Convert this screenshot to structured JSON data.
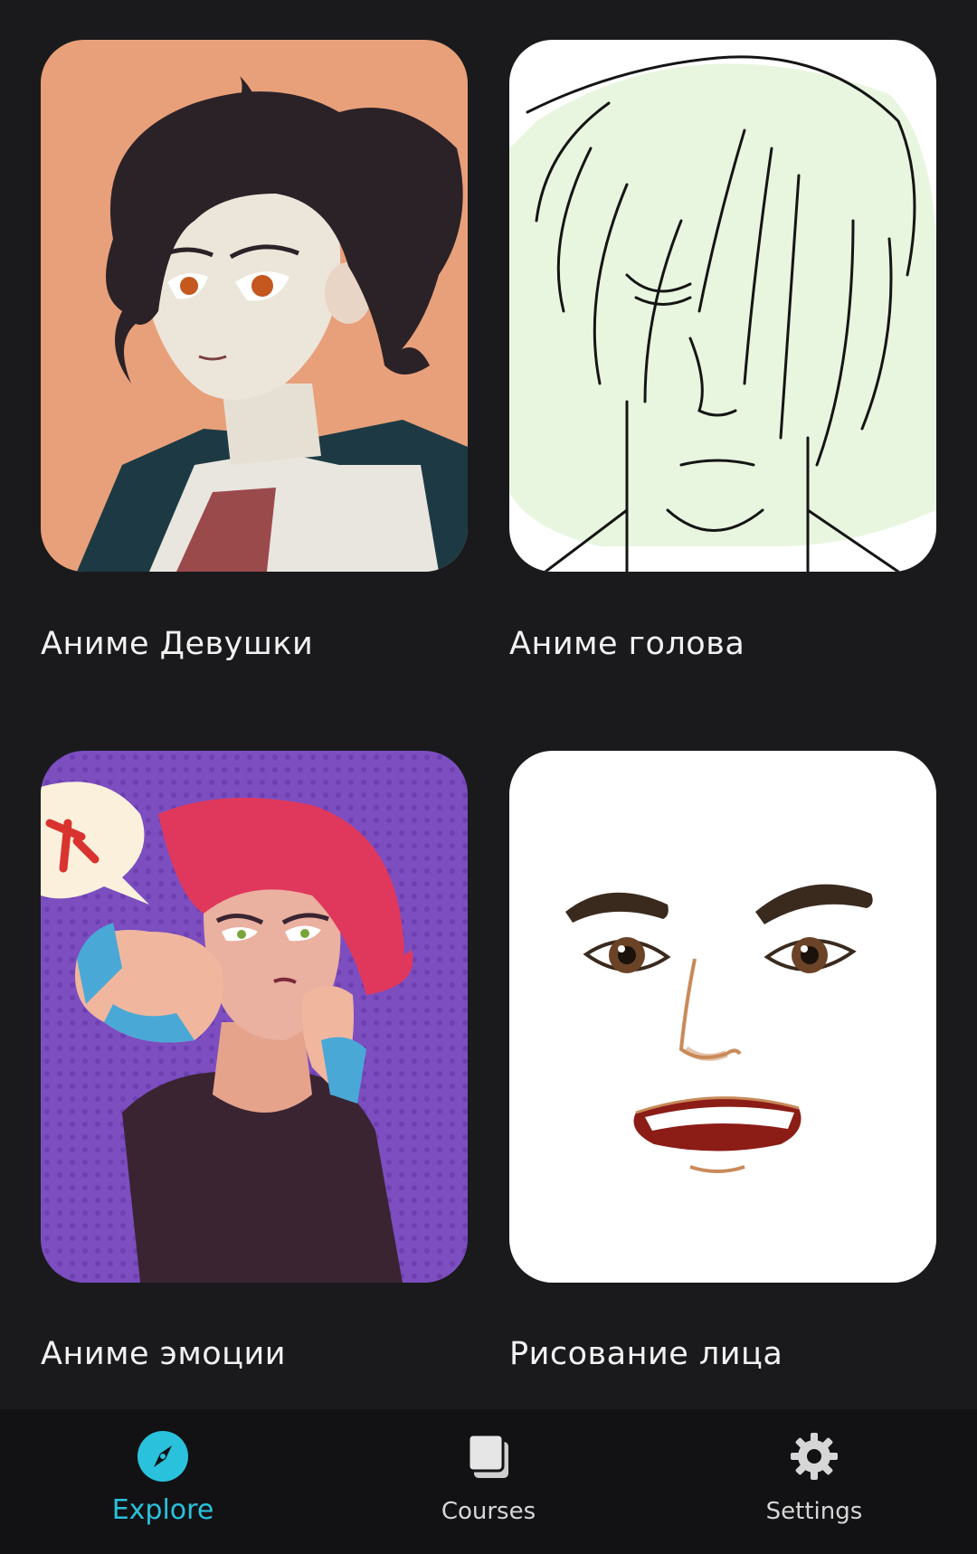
{
  "courses": [
    {
      "title": "Аниме Девушки",
      "icon": "anime-girl-illustration"
    },
    {
      "title": "Аниме голова",
      "icon": "anime-head-sketch"
    },
    {
      "title": "Аниме эмоции",
      "icon": "anime-emotions-illustration"
    },
    {
      "title": "Рисование лица",
      "icon": "angry-face-illustration"
    }
  ],
  "nav": {
    "items": [
      {
        "label": "Explore",
        "icon": "compass-icon",
        "active": true
      },
      {
        "label": "Courses",
        "icon": "stack-icon",
        "active": false
      },
      {
        "label": "Settings",
        "icon": "gear-icon",
        "active": false
      }
    ]
  },
  "colors": {
    "background": "#1a1a1c",
    "navbar": "#121214",
    "accent": "#29c1dc"
  }
}
